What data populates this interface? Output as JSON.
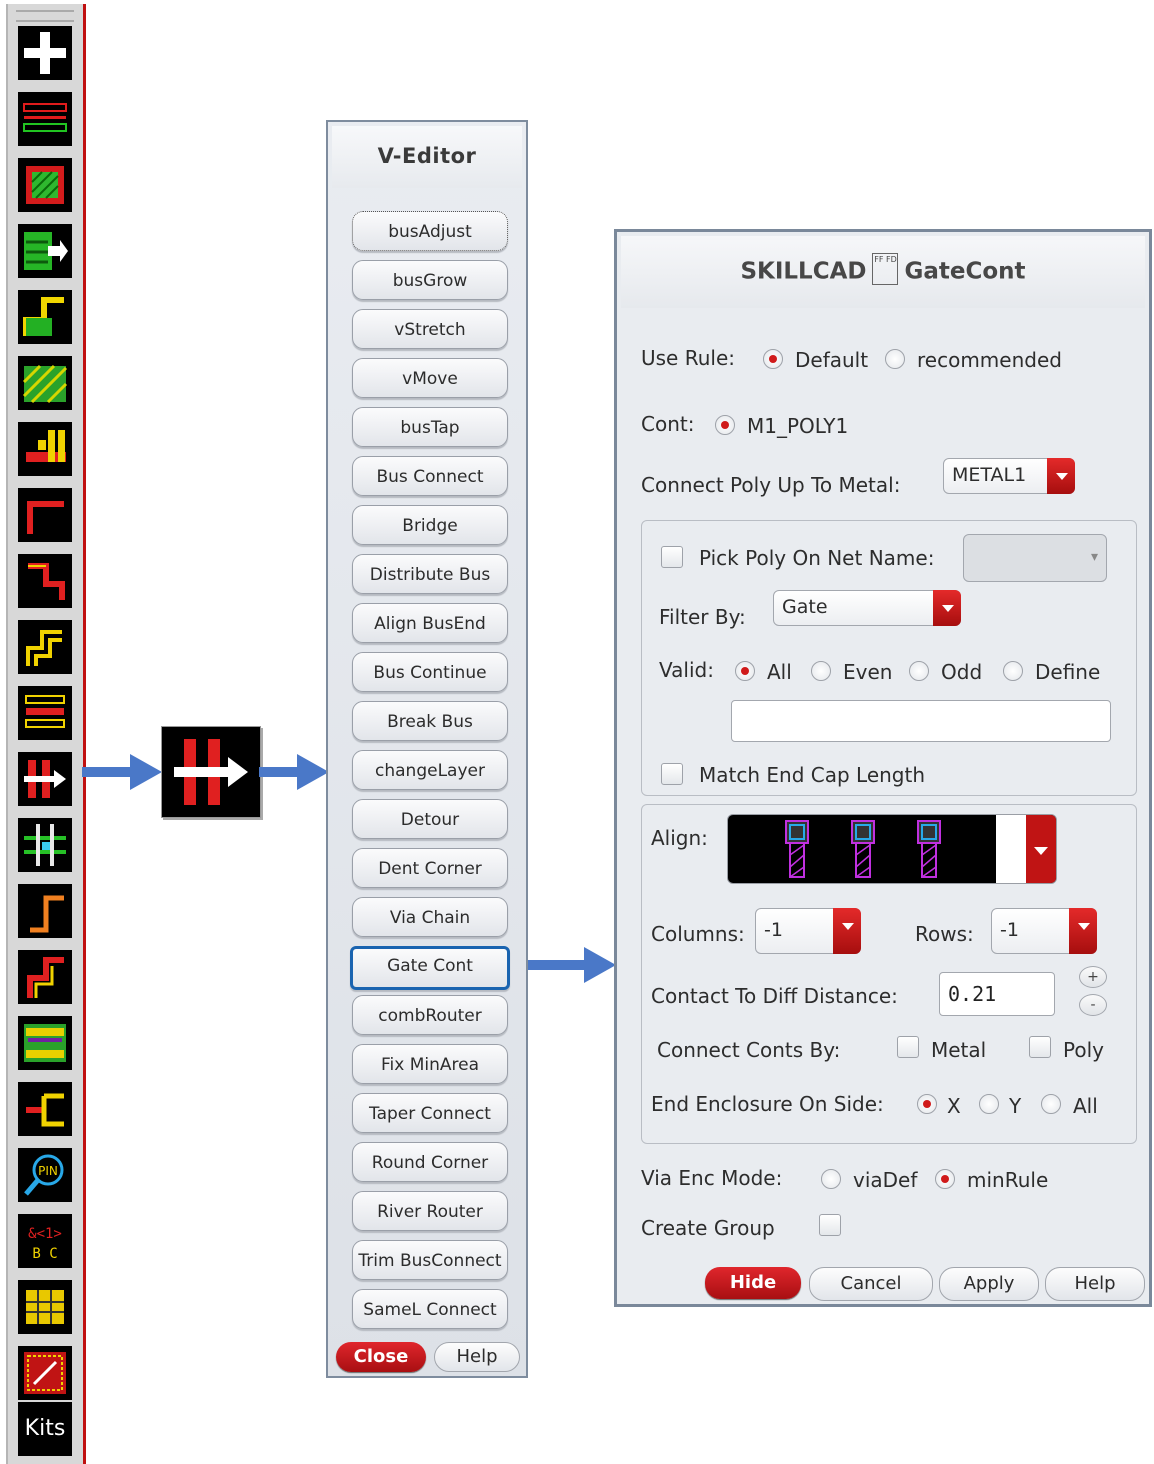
{
  "toolbar": {
    "icons": [
      "plus-icon",
      "bus-lines-icon",
      "hatched-square-icon",
      "bus-move-icon",
      "step-wire-icon",
      "hatched-block-icon",
      "bus-tap-icon",
      "corner-wire-icon",
      "step-corner-icon",
      "double-step-icon",
      "bus-stack-icon",
      "bus-stretch-icon",
      "cross-wire-icon",
      "single-corner-icon",
      "jog-corner-icon",
      "comb-router-icon",
      "bus-branch-icon",
      "pin-search-icon",
      "bus-label-icon",
      "grid-block-icon",
      "matrix-block-icon"
    ],
    "kits_label": "Kits"
  },
  "veditor": {
    "title": "V-Editor",
    "buttons": [
      "busAdjust",
      "busGrow",
      "vStretch",
      "vMove",
      "busTap",
      "Bus Connect",
      "Bridge",
      "Distribute Bus",
      "Align BusEnd",
      "Bus Continue",
      "Break Bus",
      "changeLayer",
      "Detour",
      "Dent Corner",
      "Via Chain",
      "Gate Cont",
      "combRouter",
      "Fix MinArea",
      "Taper Connect",
      "Round Corner",
      "River Router",
      "Trim BusConnect",
      "SameL Connect"
    ],
    "close_label": "Close",
    "help_label": "Help"
  },
  "gatecont": {
    "title_left": "SKILLCAD",
    "logo_text": "FF FD",
    "title_right": "GateCont",
    "use_rule": {
      "label": "Use Rule:",
      "options": [
        "Default",
        "recommended"
      ],
      "selected": "Default"
    },
    "cont": {
      "label": "Cont:",
      "value": "M1_POLY1"
    },
    "connect_poly": {
      "label": "Connect Poly Up To Metal:",
      "value": "METAL1"
    },
    "pick_poly": {
      "label": "Pick Poly On Net Name:",
      "checked": false,
      "value": ""
    },
    "filter_by": {
      "label": "Filter By:",
      "value": "Gate"
    },
    "valid": {
      "label": "Valid:",
      "options": [
        "All",
        "Even",
        "Odd",
        "Define"
      ],
      "selected": "All",
      "define_value": ""
    },
    "match_end_cap": {
      "label": "Match End Cap Length",
      "checked": false
    },
    "align": {
      "label": "Align:"
    },
    "columns": {
      "label": "Columns:",
      "value": "-1"
    },
    "rows": {
      "label": "Rows:",
      "value": "-1"
    },
    "contact_diff": {
      "label": "Contact To Diff Distance:",
      "value": "0.21",
      "plus": "+",
      "minus": "-"
    },
    "connect_conts": {
      "label": "Connect Conts By:",
      "options": [
        "Metal",
        "Poly"
      ]
    },
    "end_enclosure": {
      "label": "End Enclosure On Side:",
      "options": [
        "X",
        "Y",
        "All"
      ],
      "selected": "X"
    },
    "via_enc_mode": {
      "label": "Via Enc Mode:",
      "options": [
        "viaDef",
        "minRule"
      ],
      "selected": "minRule"
    },
    "create_group": {
      "label": "Create Group",
      "checked": false
    },
    "buttons": {
      "hide": "Hide",
      "cancel": "Cancel",
      "apply": "Apply",
      "help": "Help"
    }
  },
  "colors": {
    "accent_red": "#c8161b",
    "highlight_blue": "#1a64b0",
    "arrow_blue": "#4a78c8"
  }
}
